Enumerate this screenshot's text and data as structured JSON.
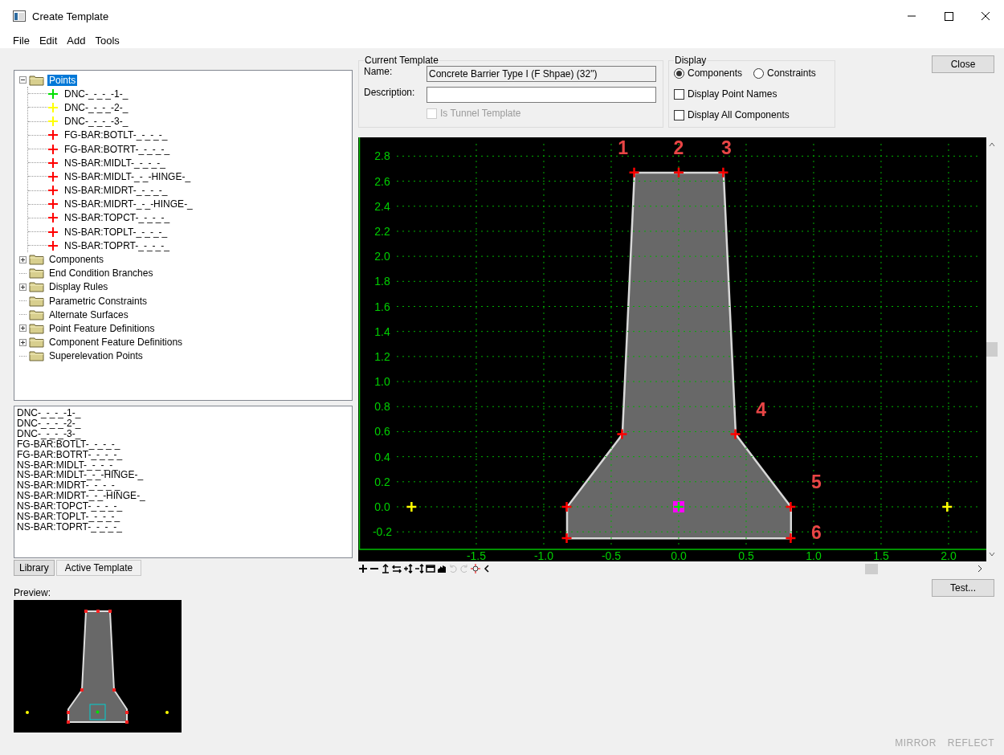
{
  "window": {
    "title": "Create Template"
  },
  "menu": [
    "File",
    "Edit",
    "Add",
    "Tools"
  ],
  "tree": [
    {
      "label": "Points",
      "kind": "expanded",
      "selected": true,
      "children": [
        {
          "label": "DNC-_-_-_-1-_",
          "color": "#00e000"
        },
        {
          "label": "DNC-_-_-_-2-_",
          "color": "#ffff00"
        },
        {
          "label": "DNC-_-_-_-3-_",
          "color": "#ffff00"
        },
        {
          "label": "FG-BAR:BOTLT-_-_-_-_",
          "color": "#ff0000"
        },
        {
          "label": "FG-BAR:BOTRT-_-_-_-_",
          "color": "#ff0000"
        },
        {
          "label": "NS-BAR:MIDLT-_-_-_-_",
          "color": "#ff0000"
        },
        {
          "label": "NS-BAR:MIDLT-_-_-HINGE-_",
          "color": "#ff0000"
        },
        {
          "label": "NS-BAR:MIDRT-_-_-_-_",
          "color": "#ff0000"
        },
        {
          "label": "NS-BAR:MIDRT-_-_-HINGE-_",
          "color": "#ff0000"
        },
        {
          "label": "NS-BAR:TOPCT-_-_-_-_",
          "color": "#ff0000"
        },
        {
          "label": "NS-BAR:TOPLT-_-_-_-_",
          "color": "#ff0000"
        },
        {
          "label": "NS-BAR:TOPRT-_-_-_-_",
          "color": "#ff0000"
        }
      ]
    },
    {
      "label": "Components",
      "kind": "collapsed",
      "selected": false
    },
    {
      "label": "End Condition Branches",
      "kind": "leaf",
      "selected": false
    },
    {
      "label": "Display Rules",
      "kind": "collapsed",
      "selected": false
    },
    {
      "label": "Parametric Constraints",
      "kind": "leaf",
      "selected": false
    },
    {
      "label": "Alternate Surfaces",
      "kind": "leaf",
      "selected": false
    },
    {
      "label": "Point Feature Definitions",
      "kind": "collapsed",
      "selected": false
    },
    {
      "label": "Component Feature Definitions",
      "kind": "collapsed",
      "selected": false
    },
    {
      "label": "Superelevation Points",
      "kind": "leaf",
      "selected": false
    }
  ],
  "point_list": [
    "DNC-_-_-_-1-_",
    "DNC-_-_-_-2-_",
    "DNC-_-_-_-3-_",
    "FG-BAR:BOTLT-_-_-_-_",
    "FG-BAR:BOTRT-_-_-_-_",
    "NS-BAR:MIDLT-_-_-_-_",
    "NS-BAR:MIDLT-_-_-HINGE-_",
    "NS-BAR:MIDRT-_-_-_-_",
    "NS-BAR:MIDRT-_-_-HINGE-_",
    "NS-BAR:TOPCT-_-_-_-_",
    "NS-BAR:TOPLT-_-_-_-_",
    "NS-BAR:TOPRT-_-_-_-_"
  ],
  "tabs": [
    {
      "label": "Library",
      "selected": false
    },
    {
      "label": "Active Template",
      "selected": true
    }
  ],
  "preview": {
    "label": "Preview:"
  },
  "current_template": {
    "legend": "Current Template",
    "name_label": "Name:",
    "name_value": "Concrete Barrier Type I (F Shpae) (32\")",
    "description_label": "Description:",
    "tunnel": {
      "label": "Is Tunnel Template",
      "checked": false,
      "disabled": true
    }
  },
  "display": {
    "legend": "Display",
    "radios": [
      {
        "label": "Components",
        "selected": true
      },
      {
        "label": "Constraints",
        "selected": false
      }
    ],
    "checkboxes": [
      {
        "label": "Display Point Names",
        "checked": false
      },
      {
        "label": "Display All Components",
        "checked": false
      }
    ]
  },
  "close_button": "Close",
  "test_button": "Test...",
  "canvas": {
    "chart_data": {
      "type": "scatter",
      "xlim": [
        -2.375,
        2.28
      ],
      "ylim": [
        -0.34,
        2.95
      ],
      "xticks": [
        {
          "value": -1.5,
          "label": "-1.5"
        },
        {
          "value": -1,
          "label": "-1.0"
        },
        {
          "value": -0.5,
          "label": "-0.5"
        },
        {
          "value": 0,
          "label": "0.0"
        },
        {
          "value": 0.5,
          "label": "0.5"
        },
        {
          "value": 1,
          "label": "1.0"
        },
        {
          "value": 1.5,
          "label": "1.5"
        },
        {
          "value": 2,
          "label": "2.0"
        }
      ],
      "yticks": [
        {
          "value": -0.2,
          "label": "-0.2"
        },
        {
          "value": 0,
          "label": "0.0"
        },
        {
          "value": 0.2,
          "label": "0.2"
        },
        {
          "value": 0.4,
          "label": "0.4"
        },
        {
          "value": 0.6,
          "label": "0.6"
        },
        {
          "value": 0.8,
          "label": "0.8"
        },
        {
          "value": 1,
          "label": "1.0"
        },
        {
          "value": 1.2,
          "label": "1.2"
        },
        {
          "value": 1.4,
          "label": "1.4"
        },
        {
          "value": 1.6,
          "label": "1.6"
        },
        {
          "value": 1.8,
          "label": "1.8"
        },
        {
          "value": 2,
          "label": "2.0"
        },
        {
          "value": 2.2,
          "label": "2.2"
        },
        {
          "value": 2.4,
          "label": "2.4"
        },
        {
          "value": 2.6,
          "label": "2.6"
        },
        {
          "value": 2.8,
          "label": "2.8"
        }
      ],
      "series": [
        {
          "color": "#ff0000",
          "x": [
            -0.83,
            -0.83,
            -0.42,
            -0.33,
            0,
            0.33,
            0.42,
            0.83,
            0.83
          ],
          "values": [
            -0.25,
            0,
            0.58,
            2.67,
            2.67,
            2.67,
            0.58,
            0,
            -0.25
          ]
        },
        {
          "color": "#ffff00",
          "x": [
            -1.98,
            1.99
          ],
          "values": [
            0,
            0
          ]
        },
        {
          "color": "#00e000",
          "x": [
            0
          ],
          "values": [
            0
          ]
        }
      ],
      "grid": true,
      "annotations": [
        {
          "text": "1",
          "x": -0.33,
          "y": 2.67
        },
        {
          "text": "2",
          "x": 0,
          "y": 2.67
        },
        {
          "text": "3",
          "x": 0.33,
          "y": 2.67
        },
        {
          "text": "4",
          "x": 0.42,
          "y": 0.58
        },
        {
          "text": "5",
          "x": 0.83,
          "y": 0
        },
        {
          "text": "6",
          "x": 0.83,
          "y": -0.25
        }
      ]
    }
  },
  "footer": [
    "MIRROR",
    "REFLECT"
  ]
}
